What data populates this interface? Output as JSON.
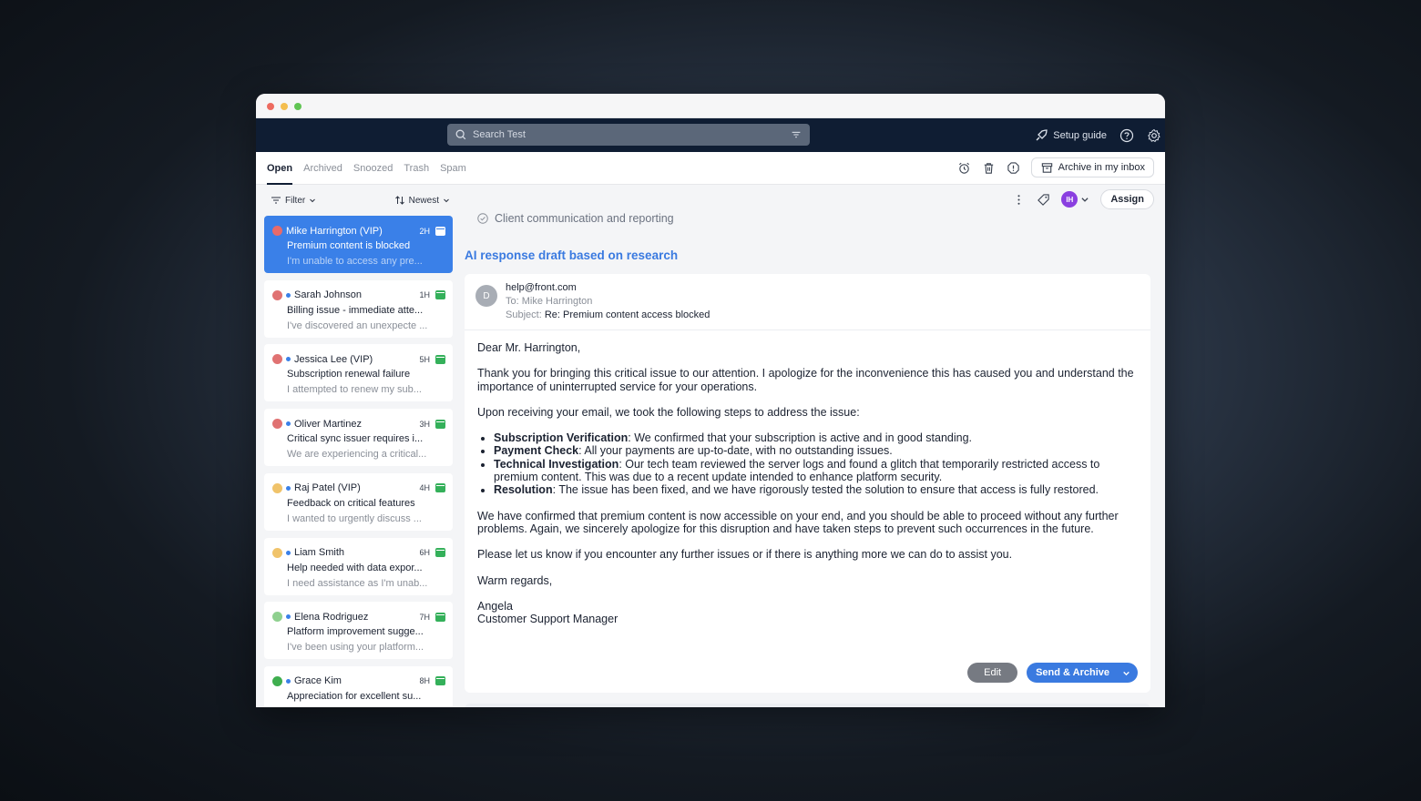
{
  "search": {
    "placeholder": "Search Test"
  },
  "topbar": {
    "setup_label": "Setup guide"
  },
  "tabs": [
    {
      "label": "Open",
      "active": true
    },
    {
      "label": "Archived"
    },
    {
      "label": "Snoozed"
    },
    {
      "label": "Trash"
    },
    {
      "label": "Spam"
    }
  ],
  "toolbar": {
    "archive_label": "Archive in my inbox"
  },
  "list": {
    "filter_label": "Filter",
    "sort_label": "Newest",
    "conversations": [
      {
        "name": "Mike Harrington (VIP)",
        "time": "2H",
        "subject": "Premium content is blocked",
        "preview": "I'm unable to access any pre...",
        "dot_color": "#e86a6a",
        "unread": false,
        "active": true
      },
      {
        "name": "Sarah Johnson",
        "time": "1H",
        "subject": "Billing issue - immediate atte...",
        "preview": "I've discovered an unexpecte ...",
        "dot_color": "#e07272",
        "unread": true
      },
      {
        "name": "Jessica Lee (VIP)",
        "time": "5H",
        "subject": "Subscription renewal failure",
        "preview": "I attempted to renew my sub...",
        "dot_color": "#e07272",
        "unread": true
      },
      {
        "name": "Oliver Martinez",
        "time": "3H",
        "subject": "Critical sync issuer requires i...",
        "preview": "We are experiencing a critical...",
        "dot_color": "#e07272",
        "unread": true
      },
      {
        "name": "Raj Patel (VIP)",
        "time": "4H",
        "subject": "Feedback on critical features",
        "preview": "I wanted to urgently discuss ...",
        "dot_color": "#f0c36a",
        "unread": true
      },
      {
        "name": "Liam Smith",
        "time": "6H",
        "subject": "Help needed with data expor...",
        "preview": "I need assistance as I'm unab...",
        "dot_color": "#f0c36a",
        "unread": true
      },
      {
        "name": "Elena Rodriguez",
        "time": "7H",
        "subject": "Platform improvement sugge...",
        "preview": "I've been using your platform...",
        "dot_color": "#8fd08f",
        "unread": true
      },
      {
        "name": "Grace Kim",
        "time": "8H",
        "subject": "Appreciation for excellent su...",
        "preview": "",
        "dot_color": "#3fae4f",
        "unread": true
      }
    ]
  },
  "main": {
    "assignee_initials": "IH",
    "assign_label": "Assign",
    "topic": "Client communication and reporting",
    "draft_title": "AI response draft based on research",
    "email": {
      "avatar": "D",
      "from": "help@front.com",
      "to": "To: Mike Harrington",
      "subject_prefix": "Subject:",
      "subject": "Re: Premium content access blocked",
      "greeting": "Dear Mr. Harrington,",
      "p1": "Thank you for bringing this critical issue to our attention. I apologize for the inconvenience this has caused you and understand the importance of uninterrupted service for your operations.",
      "p2": "Upon receiving your email, we took the following steps to address the issue:",
      "steps": [
        {
          "title": "Subscription Verification",
          "text": ": We confirmed that your subscription is active and in good standing."
        },
        {
          "title": "Payment Check",
          "text": ": All your payments are up-to-date, with no outstanding issues."
        },
        {
          "title": "Technical Investigation",
          "text": ": Our tech team reviewed the server logs and found a glitch that temporarily restricted access to premium content. This was due to a recent update intended to enhance platform security."
        },
        {
          "title": "Resolution",
          "text": ": The issue has been fixed, and we have rigorously tested the solution to ensure that access is fully restored."
        }
      ],
      "p3": "We have confirmed that premium content is now accessible on your end, and you should be able to proceed without any further problems. Again, we sincerely apologize for this disruption and have taken steps to prevent such occurrences in the future.",
      "p4": "Please let us know if you encounter any further issues or if there is anything more we can do to assist you.",
      "closing": "Warm regards,",
      "sign_name": "Angela",
      "sign_title": "Customer Support Manager"
    },
    "edit_label": "Edit",
    "send_label": "Send & Archive"
  }
}
